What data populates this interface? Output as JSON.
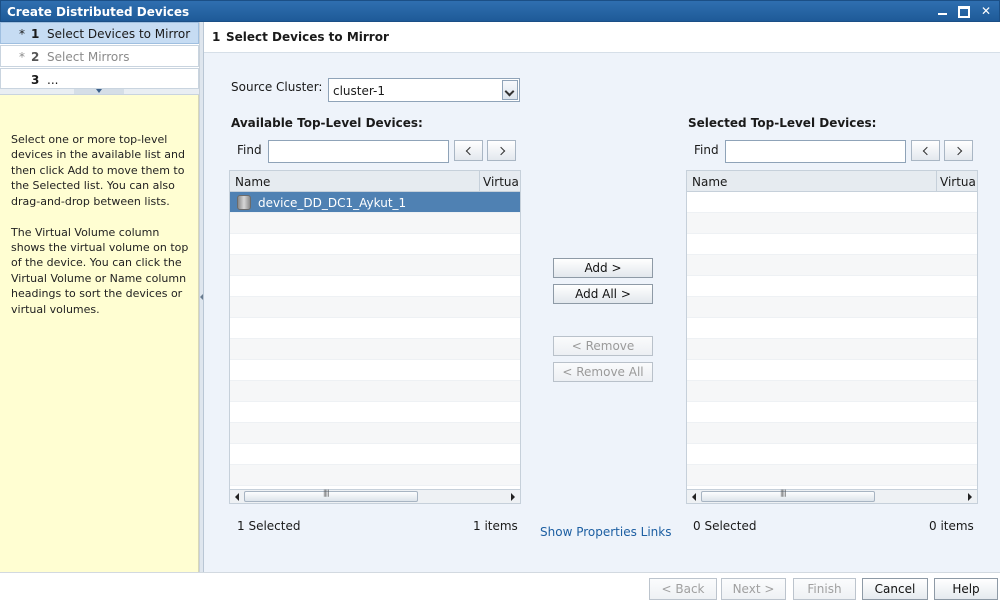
{
  "window": {
    "title": "Create Distributed Devices"
  },
  "steps": [
    {
      "star": "*",
      "num": "1",
      "label": "Select Devices to Mirror",
      "active": true
    },
    {
      "star": "*",
      "num": "2",
      "label": "Select Mirrors",
      "active": false
    },
    {
      "star": "",
      "num": "3",
      "label": "...",
      "active": false
    }
  ],
  "help": {
    "p1": "Select one or more top-level devices in the available list and then click Add to move them to the Selected list. You can also drag-and-drop between lists.",
    "p2": "The Virtual Volume column shows the virtual volume on top of the device. You can click the Virtual Volume or Name column headings to sort the devices or virtual volumes."
  },
  "header": {
    "num": "1",
    "title": "Select Devices to Mirror"
  },
  "source": {
    "label": "Source Cluster:",
    "value": "cluster-1"
  },
  "available": {
    "title": "Available Top-Level Devices:",
    "find_label": "Find",
    "find_value": "",
    "col_name": "Name",
    "col_virtual": "Virtual",
    "rows": [
      "device_DD_DC1_Aykut_1"
    ],
    "selected_count": "1 Selected",
    "items_count": "1 items"
  },
  "selected": {
    "title": "Selected Top-Level Devices:",
    "find_label": "Find",
    "find_value": "",
    "col_name": "Name",
    "col_virtual": "Virtual",
    "selected_count": "0 Selected",
    "items_count": "0 items"
  },
  "actions": {
    "add": "Add >",
    "add_all": "Add All >",
    "remove": "< Remove",
    "remove_all": "< Remove All",
    "show_properties": "Show Properties Links"
  },
  "footer": {
    "back": "< Back",
    "next": "Next >",
    "finish": "Finish",
    "cancel": "Cancel",
    "help": "Help"
  },
  "colors": {
    "titlebar": "#1e5a98",
    "selection": "#4f81b3",
    "help_bg": "#fffed2",
    "pane_bg": "#eef3fa"
  }
}
